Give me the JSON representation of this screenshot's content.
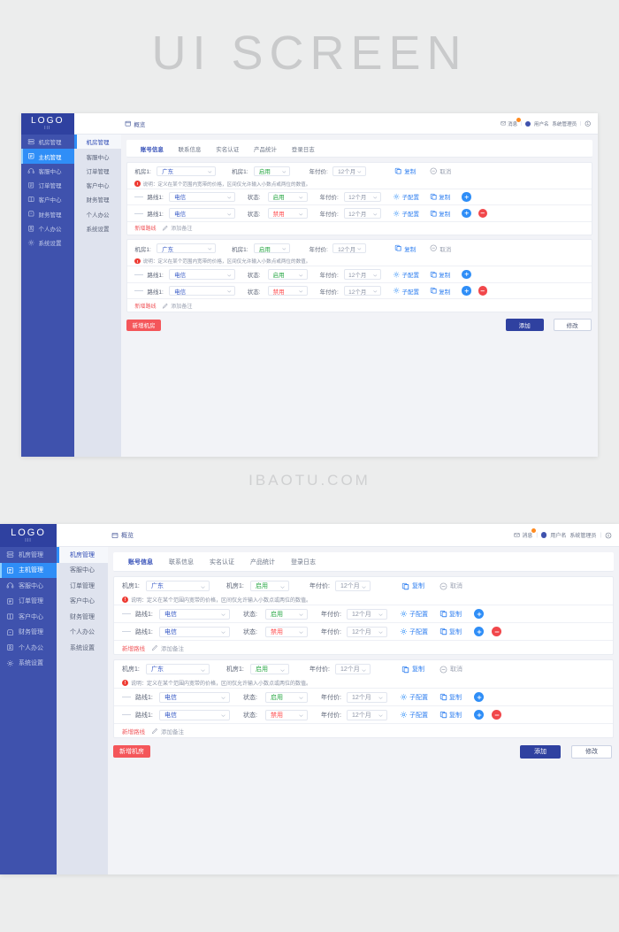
{
  "banner": {
    "title": "UI SCREEN",
    "watermark": "IBAOTU.COM"
  },
  "colors": {
    "sidebar": "#3f52ad",
    "logo_bg": "#2f41a0",
    "accent_blue": "#2f8ef7",
    "link_blue": "#2f7ff0",
    "enabled_green": "#28a745",
    "disabled_red": "#ff4d4f",
    "danger_red": "#f4565a",
    "navy_button": "#2f41a0",
    "page_bg": "#f2f3f7"
  },
  "app": {
    "logo": {
      "text": "LOGO",
      "sub": "III"
    },
    "sidebar": {
      "items": [
        {
          "label": "机房管理",
          "icon": "server-icon",
          "active": false
        },
        {
          "label": "主机管理",
          "icon": "host-icon",
          "active": true
        },
        {
          "label": "客服中心",
          "icon": "headset-icon",
          "active": false
        },
        {
          "label": "订单管理",
          "icon": "order-icon",
          "active": false
        },
        {
          "label": "客户中心",
          "icon": "customer-icon",
          "active": false
        },
        {
          "label": "财务管理",
          "icon": "finance-icon",
          "active": false
        },
        {
          "label": "个人办公",
          "icon": "person-icon",
          "active": false
        },
        {
          "label": "系统设置",
          "icon": "gear-icon",
          "active": false
        }
      ]
    },
    "subnav": {
      "header": "机房管理",
      "items": [
        {
          "label": "机房管理",
          "active": true
        },
        {
          "label": "客服中心",
          "active": false
        },
        {
          "label": "订单管理",
          "active": false
        },
        {
          "label": "客户中心",
          "active": false
        },
        {
          "label": "财务管理",
          "active": false
        },
        {
          "label": "个人办公",
          "active": false
        },
        {
          "label": "系统设置",
          "active": false
        }
      ]
    },
    "topbar": {
      "breadcrumb": {
        "icon": "window-icon",
        "label": "概览"
      },
      "mail": {
        "icon": "mail-icon",
        "label": "消息",
        "badge": ""
      },
      "separator": "|",
      "user": {
        "avatar": "avatar",
        "name": "用户名",
        "role": "系统管理员"
      },
      "logout": {
        "icon": "logout-icon"
      }
    },
    "tabs": [
      {
        "label": "账号信息",
        "active": true
      },
      {
        "label": "联系信息",
        "active": false
      },
      {
        "label": "实名认证",
        "active": false
      },
      {
        "label": "产品统计",
        "active": false
      },
      {
        "label": "登录日志",
        "active": false
      }
    ],
    "groups": [
      {
        "header": {
          "room_label": "机房1:",
          "room_value": "广东",
          "status_label": "机房1:",
          "status_value": "启用",
          "price_label": "年付价:",
          "price_value": "12个月",
          "copy_label": "复制",
          "copy_icon": "copy-icon",
          "cancel_label": "取消",
          "cancel_icon": "minus-circle-icon"
        },
        "notice": {
          "icon": "warning-icon",
          "text": "说明：定义在某个范围内宽带的价格，区间仅允许输入小数点或两位的数值。"
        },
        "rows": [
          {
            "route_label": "路线1:",
            "route_value": "电信",
            "status_label": "状态:",
            "status_value": "启用",
            "status_kind": "enabled",
            "price_label": "年付价:",
            "price_value": "12个月",
            "config_label": "子配置",
            "config_icon": "gear-icon",
            "copy_label": "复制",
            "copy_icon": "copy-icon",
            "add_icon": "plus-circle-icon",
            "remove_icon": "minus-circle-icon",
            "has_remove": false
          },
          {
            "route_label": "路线1:",
            "route_value": "电信",
            "status_label": "状态:",
            "status_value": "禁用",
            "status_kind": "disabled",
            "price_label": "年付价:",
            "price_value": "12个月",
            "config_label": "子配置",
            "config_icon": "gear-icon",
            "copy_label": "复制",
            "copy_icon": "copy-icon",
            "add_icon": "plus-circle-icon",
            "remove_icon": "minus-circle-icon",
            "has_remove": true
          }
        ],
        "footer": {
          "add_route_label": "新增路线",
          "add_note_label": "添加备注",
          "add_note_icon": "pencil-icon"
        }
      },
      {
        "header": {
          "room_label": "机房1:",
          "room_value": "广东",
          "status_label": "机房1:",
          "status_value": "启用",
          "price_label": "年付价:",
          "price_value": "12个月",
          "copy_label": "复制",
          "copy_icon": "copy-icon",
          "cancel_label": "取消",
          "cancel_icon": "minus-circle-icon"
        },
        "notice": {
          "icon": "warning-icon",
          "text": "说明：定义在某个范围内宽带的价格，区间仅允许输入小数点或两位的数值。"
        },
        "rows": [
          {
            "route_label": "路线1:",
            "route_value": "电信",
            "status_label": "状态:",
            "status_value": "启用",
            "status_kind": "enabled",
            "price_label": "年付价:",
            "price_value": "12个月",
            "config_label": "子配置",
            "config_icon": "gear-icon",
            "copy_label": "复制",
            "copy_icon": "copy-icon",
            "add_icon": "plus-circle-icon",
            "remove_icon": "minus-circle-icon",
            "has_remove": false
          },
          {
            "route_label": "路线1:",
            "route_value": "电信",
            "status_label": "状态:",
            "status_value": "禁用",
            "status_kind": "disabled",
            "price_label": "年付价:",
            "price_value": "12个月",
            "config_label": "子配置",
            "config_icon": "gear-icon",
            "copy_label": "复制",
            "copy_icon": "copy-icon",
            "add_icon": "plus-circle-icon",
            "remove_icon": "minus-circle-icon",
            "has_remove": true
          }
        ],
        "footer": {
          "add_route_label": "新增路线",
          "add_note_label": "添加备注",
          "add_note_icon": "pencil-icon"
        }
      }
    ],
    "actions": {
      "new_room_label": "新增机房",
      "submit_label": "添加",
      "modify_label": "修改"
    }
  }
}
